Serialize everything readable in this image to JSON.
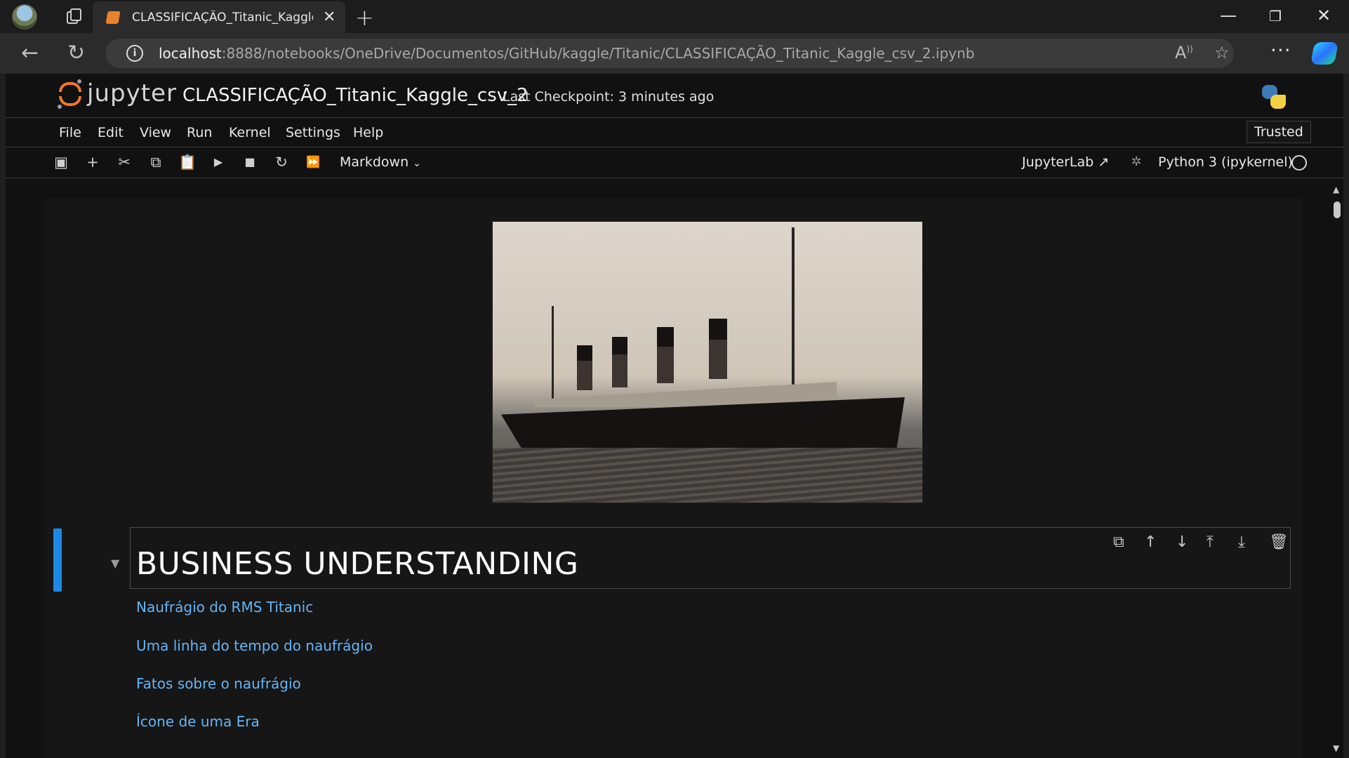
{
  "browser": {
    "tab_title": "CLASSIFICAÇÃO_Titanic_Kaggle_",
    "url_host": "localhost",
    "url_rest": ":8888/notebooks/OneDrive/Documentos/GitHub/kaggle/Titanic/CLASSIFICAÇÃO_Titanic_Kaggle_csv_2.ipynb"
  },
  "jupyter": {
    "wordmark": "jupyter",
    "notebook_name": "CLASSIFICAÇÃO_Titanic_Kaggle_csv_2",
    "checkpoint": "Last Checkpoint: 3 minutes ago",
    "menu": [
      "File",
      "Edit",
      "View",
      "Run",
      "Kernel",
      "Settings",
      "Help"
    ],
    "trusted": "Trusted",
    "cell_type": "Markdown",
    "jupyterlab_link": "JupyterLab",
    "kernel": "Python 3 (ipykernel)"
  },
  "notebook": {
    "heading": "BUSINESS UNDERSTANDING",
    "links": [
      "Naufrágio do RMS Titanic",
      "Uma linha do tempo do naufrágio",
      "Fatos sobre o naufrágio",
      "Ícone de uma Era"
    ]
  }
}
